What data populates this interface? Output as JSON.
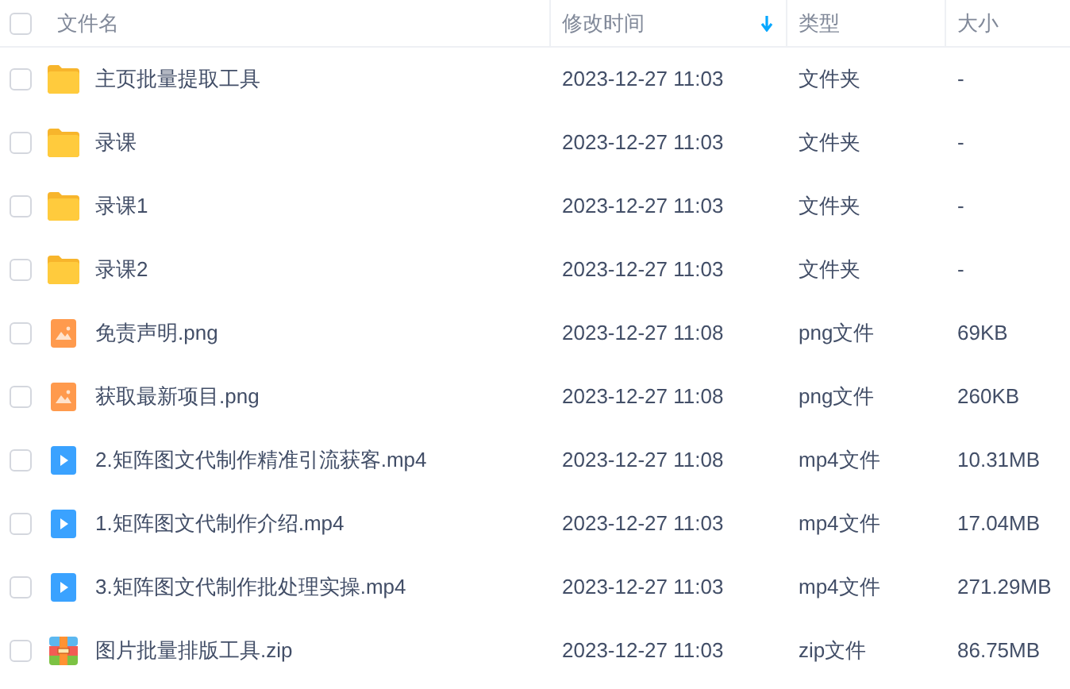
{
  "header": {
    "checked": false,
    "columns": [
      {
        "label": "文件名",
        "sorted": false
      },
      {
        "label": "修改时间",
        "sorted": true
      },
      {
        "label": "类型",
        "sorted": false
      },
      {
        "label": "大小",
        "sorted": false
      }
    ]
  },
  "rows": [
    {
      "kind": "folder",
      "name": "主页批量提取工具",
      "modified": "2023-12-27 11:03",
      "type": "文件夹",
      "size": "-",
      "checked": false
    },
    {
      "kind": "folder",
      "name": "录课",
      "modified": "2023-12-27 11:03",
      "type": "文件夹",
      "size": "-",
      "checked": false
    },
    {
      "kind": "folder",
      "name": "录课1",
      "modified": "2023-12-27 11:03",
      "type": "文件夹",
      "size": "-",
      "checked": false
    },
    {
      "kind": "folder",
      "name": "录课2",
      "modified": "2023-12-27 11:03",
      "type": "文件夹",
      "size": "-",
      "checked": false
    },
    {
      "kind": "image",
      "name": "免责声明.png",
      "modified": "2023-12-27 11:08",
      "type": "png文件",
      "size": "69KB",
      "checked": false
    },
    {
      "kind": "image",
      "name": "获取最新项目.png",
      "modified": "2023-12-27 11:08",
      "type": "png文件",
      "size": "260KB",
      "checked": false
    },
    {
      "kind": "video",
      "name": "2.矩阵图文代制作精准引流获客.mp4",
      "modified": "2023-12-27 11:08",
      "type": "mp4文件",
      "size": "10.31MB",
      "checked": false
    },
    {
      "kind": "video",
      "name": "1.矩阵图文代制作介绍.mp4",
      "modified": "2023-12-27 11:03",
      "type": "mp4文件",
      "size": "17.04MB",
      "checked": false
    },
    {
      "kind": "video",
      "name": "3.矩阵图文代制作批处理实操.mp4",
      "modified": "2023-12-27 11:03",
      "type": "mp4文件",
      "size": "271.29MB",
      "checked": false
    },
    {
      "kind": "zip",
      "name": "图片批量排版工具.zip",
      "modified": "2023-12-27 11:03",
      "type": "zip文件",
      "size": "86.75MB",
      "checked": false
    }
  ]
}
